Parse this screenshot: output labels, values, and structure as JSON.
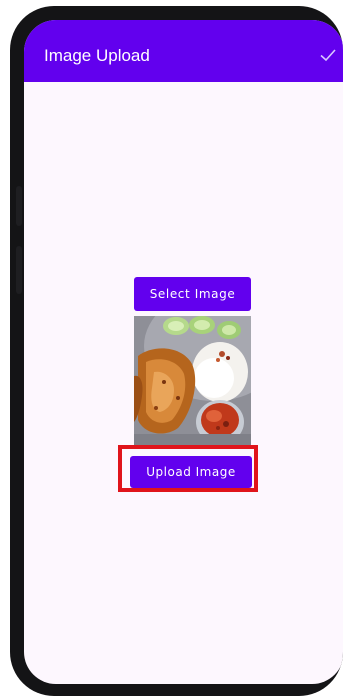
{
  "app_bar": {
    "title": "Image Upload",
    "confirm_icon": "checkmark-icon",
    "color": "#6200ee"
  },
  "main": {
    "select_button_label": "Select Image",
    "upload_button_label": "Upload Image",
    "preview_image": "fried-chicken-rice-plate",
    "highlight_color": "#e0141b"
  }
}
